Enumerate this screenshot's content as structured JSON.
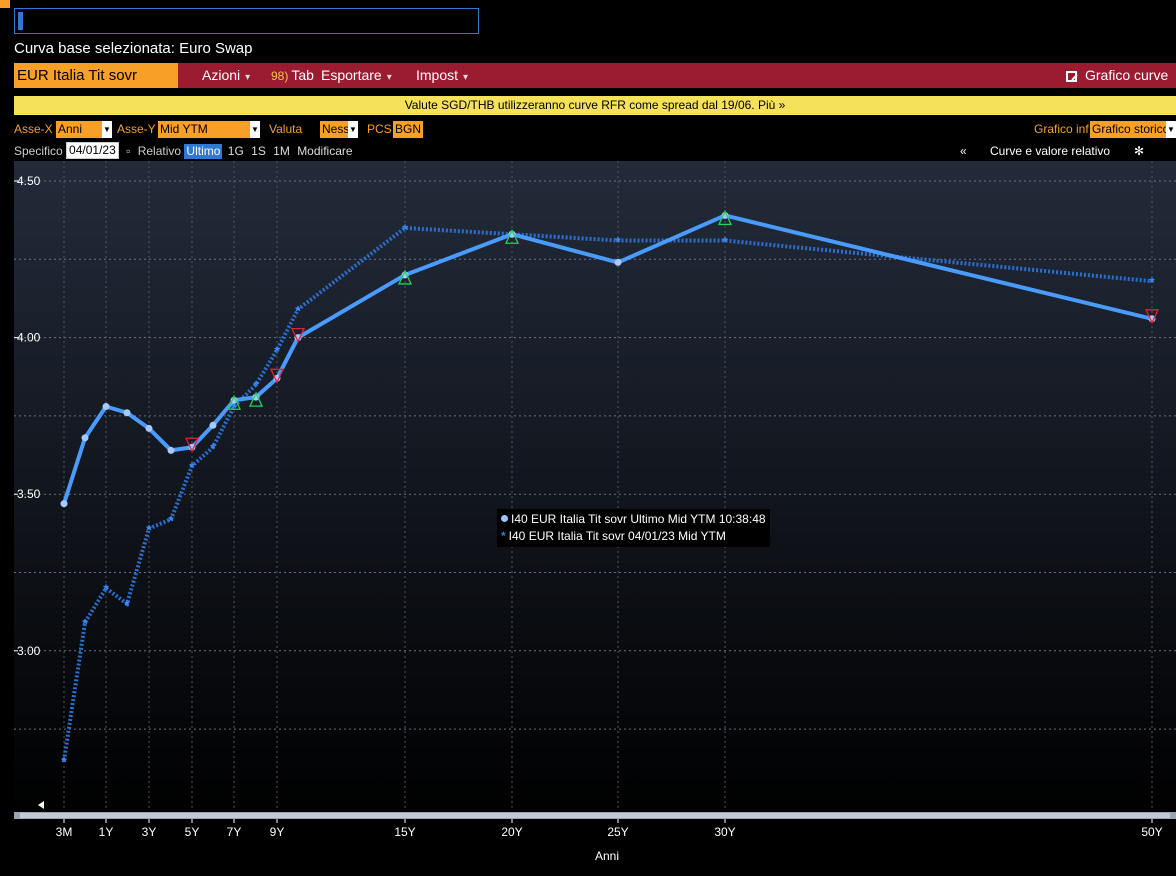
{
  "header": {
    "base_curve": "Curva base selezionata: Euro Swap"
  },
  "toolbar": {
    "ticker": "EUR Italia Tit sovr",
    "actions": "Azioni",
    "tab_num": "98)",
    "tab": "Tab",
    "export": "Esportare",
    "settings": "Impost",
    "curve_graph": "Grafico curve"
  },
  "notice": "Valute SGD/THB utilizzeranno curve RFR come spread dal 19/06. Più »",
  "controls": {
    "x_axis_label": "Asse-X",
    "x_axis_value": "Anni",
    "y_axis_label": "Asse-Y",
    "y_axis_value": "Mid YTM",
    "currency_label": "Valuta",
    "currency_value": "Ness",
    "pcs_label": "PCS",
    "pcs_value": "BGN",
    "lower_chart_label": "Grafico inf",
    "lower_chart_value": "Grafico storico"
  },
  "spec": {
    "specific_label": "Specifico",
    "date": "04/01/23",
    "relative_label": "Relativo",
    "toggles": [
      "Ultimo",
      "1G",
      "1S",
      "1M",
      "Modificare"
    ],
    "collapse": "«",
    "rel_value": "Curve e valore relativo",
    "gear": "gear-icon"
  },
  "chart_data": {
    "type": "line",
    "xlabel": "Anni",
    "ylabel": "",
    "ylim": [
      2.5,
      4.6
    ],
    "yticks": [
      "4.50",
      "4.00",
      "3.50",
      "3.00"
    ],
    "x_ticks": [
      "3M",
      "1Y",
      "3Y",
      "5Y",
      "7Y",
      "9Y",
      "15Y",
      "20Y",
      "25Y",
      "30Y",
      "50Y"
    ],
    "grid": true,
    "legend_position": "center",
    "series": [
      {
        "name": "I40 EUR Italia Tit sovr Ultimo Mid YTM 10:38:48",
        "color": "#4a9bff",
        "style": "solid",
        "x": [
          0.25,
          0.75,
          1,
          2,
          3,
          4,
          5,
          6,
          7,
          8,
          9,
          10,
          15,
          20,
          25,
          30,
          50
        ],
        "y": [
          3.47,
          3.68,
          3.78,
          3.76,
          3.71,
          3.64,
          3.65,
          3.72,
          3.8,
          3.81,
          3.87,
          4.0,
          4.2,
          4.33,
          4.24,
          4.39,
          4.06
        ]
      },
      {
        "name": "I40 EUR Italia Tit sovr 04/01/23 Mid YTM",
        "color": "#2a6fd0",
        "style": "dotted",
        "x": [
          0.25,
          0.75,
          1,
          2,
          3,
          4,
          5,
          6,
          7,
          8,
          9,
          10,
          15,
          20,
          25,
          30,
          50
        ],
        "y": [
          2.65,
          3.09,
          3.2,
          3.15,
          3.39,
          3.42,
          3.59,
          3.65,
          3.78,
          3.85,
          3.96,
          4.09,
          4.35,
          4.33,
          4.31,
          4.31,
          4.18
        ]
      }
    ],
    "markers_up": [
      7,
      8,
      15,
      20,
      30
    ],
    "markers_down": [
      5,
      9,
      10,
      50
    ]
  }
}
